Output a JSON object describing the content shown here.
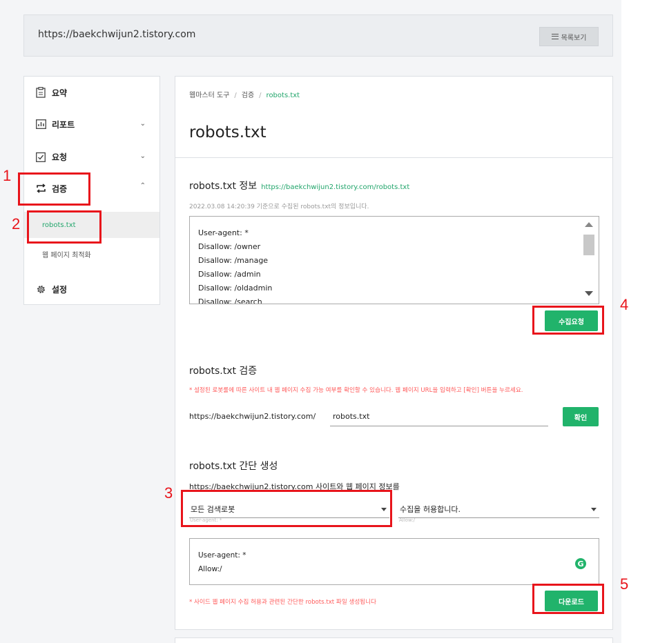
{
  "site_url": "https://baekchwijun2.tistory.com",
  "list_button": "목록보기",
  "sidebar": {
    "items": [
      {
        "label": "요약",
        "icon": "clipboard-icon"
      },
      {
        "label": "리포트",
        "icon": "chart-icon"
      },
      {
        "label": "요청",
        "icon": "check-clipboard-icon"
      },
      {
        "label": "검증",
        "icon": "repeat-icon"
      },
      {
        "label": "설정",
        "icon": "gear-icon"
      }
    ],
    "sub_items": [
      "robots.txt",
      "웹 페이지 최적화"
    ]
  },
  "breadcrumb": [
    "웹마스터 도구",
    "검증",
    "robots.txt"
  ],
  "page_title": "robots.txt",
  "info_section": {
    "title": "robots.txt 정보",
    "link": "https://baekchwijun2.tistory.com/robots.txt",
    "meta": "2022.03.08 14:20:39 기준으로 수집된 robots.txt의 정보입니다.",
    "lines": [
      "User-agent: *",
      "Disallow: /owner",
      "Disallow: /manage",
      "Disallow: /admin",
      "Disallow: /oldadmin",
      "Disallow: /search"
    ],
    "collect_button": "수집요청"
  },
  "verify_section": {
    "title": "robots.txt 검증",
    "warning": "* 설정된 로봇룰에 따른 사이트 내 웹 페이지 수집 가능 여부를 확인할 수 있습니다. 웹 페이지 URL을 입력하고 [확인] 버튼을 누르세요.",
    "url_prefix": "https://baekchwijun2.tistory.com/",
    "path_value": "robots.txt",
    "confirm_button": "확인"
  },
  "generate_section": {
    "title": "robots.txt 간단 생성",
    "description": "https://baekchwijun2.tistory.com 사이트와 웹 페이지 정보를",
    "agent_select": "모든 검색로봇",
    "agent_hint": "User-agent: *",
    "allow_select": "수집을 허용합니다.",
    "allow_hint": "Allow:/",
    "lines": [
      "User-agent: *",
      "Allow:/"
    ],
    "footer": "* 사이드 웹 페이지 수집 허용과 관련된 간단한 robots.txt 파일 생성됩니다",
    "download_button": "다운로드"
  },
  "annotations": [
    "1",
    "2",
    "3",
    "4",
    "5"
  ],
  "colors": {
    "accent": "#21b36b",
    "annotation": "#e8141b",
    "warning": "#ff5a5a"
  }
}
